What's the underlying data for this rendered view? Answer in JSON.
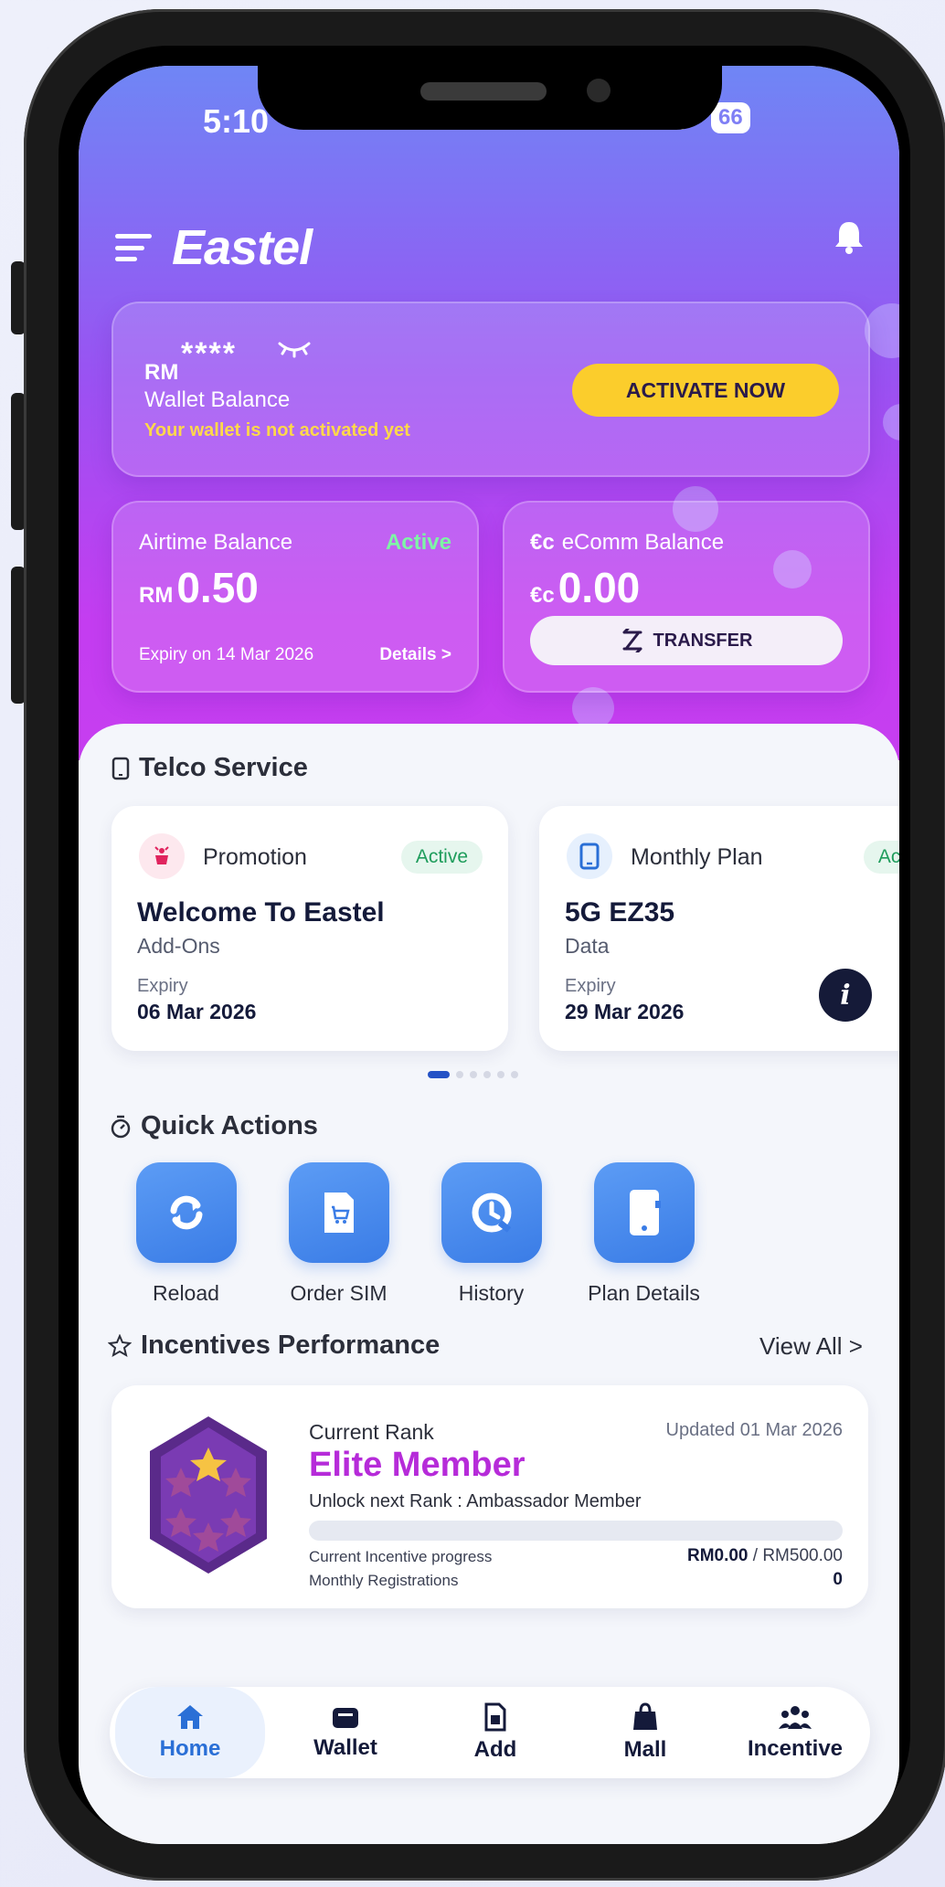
{
  "status_bar": {
    "time": "5:10",
    "battery": "66"
  },
  "header": {
    "brand": "Eastel"
  },
  "wallet": {
    "currency": "RM",
    "masked_balance": "****",
    "label": "Wallet Balance",
    "warning": "Your wallet is not activated yet",
    "activate_label": "ACTIVATE NOW"
  },
  "airtime": {
    "label": "Airtime Balance",
    "status": "Active",
    "currency": "RM",
    "amount": "0.50",
    "expiry": "Expiry on 14 Mar 2026",
    "details_label": "Details >"
  },
  "ecomm": {
    "label": "eComm Balance",
    "currency": "€c",
    "amount": "0.00",
    "transfer_label": "TRANSFER"
  },
  "telco": {
    "title": "Telco Service",
    "cards": [
      {
        "type": "Promotion",
        "status": "Active",
        "name": "Welcome To Eastel",
        "sub": "Add-Ons",
        "expiry_label": "Expiry",
        "expiry_date": "06 Mar 2026"
      },
      {
        "type": "Monthly Plan",
        "status": "Active",
        "name": "5G EZ35",
        "sub": "Data",
        "expiry_label": "Expiry",
        "expiry_date": "29 Mar 2026"
      }
    ],
    "info_label": "i",
    "add_label": "+"
  },
  "quick_actions": {
    "title": "Quick Actions",
    "items": [
      {
        "label": "Reload",
        "icon": "reload-icon"
      },
      {
        "label": "Order SIM",
        "icon": "sim-cart-icon"
      },
      {
        "label": "History",
        "icon": "history-icon"
      },
      {
        "label": "Plan Details",
        "icon": "phone-icon"
      }
    ]
  },
  "incentives": {
    "title": "Incentives Performance",
    "view_all": "View All >",
    "current_rank_label": "Current Rank",
    "updated": "Updated 01 Mar 2026",
    "rank_name": "Elite Member",
    "next_rank": "Unlock next Rank : Ambassador Member",
    "progress_label": "Current Incentive progress",
    "progress_current": "RM0.00",
    "progress_target": " / RM500.00",
    "progress_fraction": 0,
    "registrations_label": "Monthly Registrations",
    "registrations_value": "0"
  },
  "bottom_nav": {
    "items": [
      {
        "label": "Home",
        "icon": "home-icon",
        "active": true
      },
      {
        "label": "Wallet",
        "icon": "wallet-icon"
      },
      {
        "label": "Add",
        "icon": "add-sim-icon"
      },
      {
        "label": "Mall",
        "icon": "shopping-bag-icon"
      },
      {
        "label": "Incentive",
        "icon": "team-icon"
      }
    ]
  },
  "colors": {
    "accent": "#a12ff0",
    "brand_blue": "#3a7ce6",
    "active_green": "#1f9d5c",
    "warning_yellow": "#fbcd2c"
  }
}
